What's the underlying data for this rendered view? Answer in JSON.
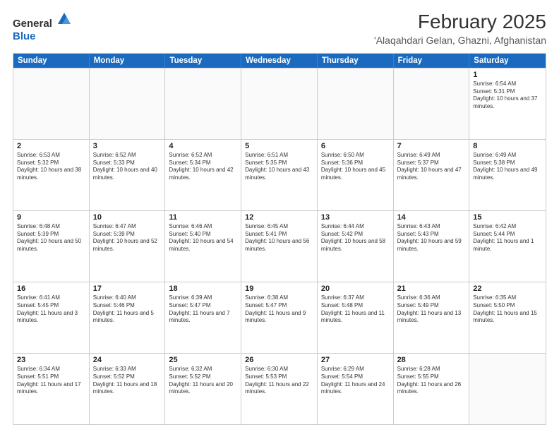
{
  "header": {
    "logo_general": "General",
    "logo_blue": "Blue",
    "title": "February 2025",
    "subtitle": "'Alaqahdari Gelan, Ghazni, Afghanistan"
  },
  "calendar": {
    "days_of_week": [
      "Sunday",
      "Monday",
      "Tuesday",
      "Wednesday",
      "Thursday",
      "Friday",
      "Saturday"
    ],
    "rows": [
      [
        {
          "day": "",
          "text": ""
        },
        {
          "day": "",
          "text": ""
        },
        {
          "day": "",
          "text": ""
        },
        {
          "day": "",
          "text": ""
        },
        {
          "day": "",
          "text": ""
        },
        {
          "day": "",
          "text": ""
        },
        {
          "day": "1",
          "text": "Sunrise: 6:54 AM\nSunset: 5:31 PM\nDaylight: 10 hours and 37 minutes."
        }
      ],
      [
        {
          "day": "2",
          "text": "Sunrise: 6:53 AM\nSunset: 5:32 PM\nDaylight: 10 hours and 38 minutes."
        },
        {
          "day": "3",
          "text": "Sunrise: 6:52 AM\nSunset: 5:33 PM\nDaylight: 10 hours and 40 minutes."
        },
        {
          "day": "4",
          "text": "Sunrise: 6:52 AM\nSunset: 5:34 PM\nDaylight: 10 hours and 42 minutes."
        },
        {
          "day": "5",
          "text": "Sunrise: 6:51 AM\nSunset: 5:35 PM\nDaylight: 10 hours and 43 minutes."
        },
        {
          "day": "6",
          "text": "Sunrise: 6:50 AM\nSunset: 5:36 PM\nDaylight: 10 hours and 45 minutes."
        },
        {
          "day": "7",
          "text": "Sunrise: 6:49 AM\nSunset: 5:37 PM\nDaylight: 10 hours and 47 minutes."
        },
        {
          "day": "8",
          "text": "Sunrise: 6:49 AM\nSunset: 5:38 PM\nDaylight: 10 hours and 49 minutes."
        }
      ],
      [
        {
          "day": "9",
          "text": "Sunrise: 6:48 AM\nSunset: 5:39 PM\nDaylight: 10 hours and 50 minutes."
        },
        {
          "day": "10",
          "text": "Sunrise: 6:47 AM\nSunset: 5:39 PM\nDaylight: 10 hours and 52 minutes."
        },
        {
          "day": "11",
          "text": "Sunrise: 6:46 AM\nSunset: 5:40 PM\nDaylight: 10 hours and 54 minutes."
        },
        {
          "day": "12",
          "text": "Sunrise: 6:45 AM\nSunset: 5:41 PM\nDaylight: 10 hours and 56 minutes."
        },
        {
          "day": "13",
          "text": "Sunrise: 6:44 AM\nSunset: 5:42 PM\nDaylight: 10 hours and 58 minutes."
        },
        {
          "day": "14",
          "text": "Sunrise: 6:43 AM\nSunset: 5:43 PM\nDaylight: 10 hours and 59 minutes."
        },
        {
          "day": "15",
          "text": "Sunrise: 6:42 AM\nSunset: 5:44 PM\nDaylight: 11 hours and 1 minute."
        }
      ],
      [
        {
          "day": "16",
          "text": "Sunrise: 6:41 AM\nSunset: 5:45 PM\nDaylight: 11 hours and 3 minutes."
        },
        {
          "day": "17",
          "text": "Sunrise: 6:40 AM\nSunset: 5:46 PM\nDaylight: 11 hours and 5 minutes."
        },
        {
          "day": "18",
          "text": "Sunrise: 6:39 AM\nSunset: 5:47 PM\nDaylight: 11 hours and 7 minutes."
        },
        {
          "day": "19",
          "text": "Sunrise: 6:38 AM\nSunset: 5:47 PM\nDaylight: 11 hours and 9 minutes."
        },
        {
          "day": "20",
          "text": "Sunrise: 6:37 AM\nSunset: 5:48 PM\nDaylight: 11 hours and 11 minutes."
        },
        {
          "day": "21",
          "text": "Sunrise: 6:36 AM\nSunset: 5:49 PM\nDaylight: 11 hours and 13 minutes."
        },
        {
          "day": "22",
          "text": "Sunrise: 6:35 AM\nSunset: 5:50 PM\nDaylight: 11 hours and 15 minutes."
        }
      ],
      [
        {
          "day": "23",
          "text": "Sunrise: 6:34 AM\nSunset: 5:51 PM\nDaylight: 11 hours and 17 minutes."
        },
        {
          "day": "24",
          "text": "Sunrise: 6:33 AM\nSunset: 5:52 PM\nDaylight: 11 hours and 18 minutes."
        },
        {
          "day": "25",
          "text": "Sunrise: 6:32 AM\nSunset: 5:52 PM\nDaylight: 11 hours and 20 minutes."
        },
        {
          "day": "26",
          "text": "Sunrise: 6:30 AM\nSunset: 5:53 PM\nDaylight: 11 hours and 22 minutes."
        },
        {
          "day": "27",
          "text": "Sunrise: 6:29 AM\nSunset: 5:54 PM\nDaylight: 11 hours and 24 minutes."
        },
        {
          "day": "28",
          "text": "Sunrise: 6:28 AM\nSunset: 5:55 PM\nDaylight: 11 hours and 26 minutes."
        },
        {
          "day": "",
          "text": ""
        }
      ]
    ]
  }
}
